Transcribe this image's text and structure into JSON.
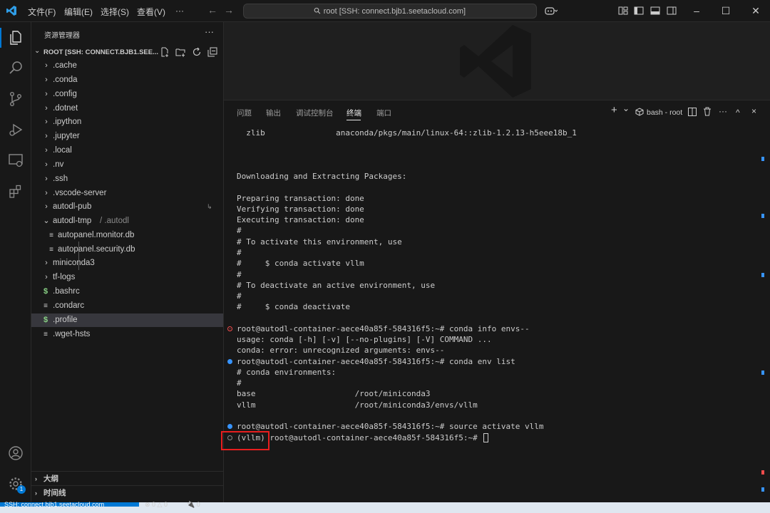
{
  "titlebar": {
    "menus": [
      "文件(F)",
      "编辑(E)",
      "选择(S)",
      "查看(V)",
      "···"
    ],
    "command_center": "root [SSH: connect.bjb1.seetacloud.com]",
    "back": "←",
    "forward": "→"
  },
  "sidebar": {
    "title": "资源管理器",
    "more": "···",
    "root_label": "ROOT [SSH: CONNECT.BJB1.SEE...",
    "items": [
      {
        "label": ".cache",
        "icon": "chevron-right-icon"
      },
      {
        "label": ".conda",
        "icon": "chevron-right-icon"
      },
      {
        "label": ".config",
        "icon": "chevron-right-icon"
      },
      {
        "label": ".dotnet",
        "icon": "chevron-right-icon"
      },
      {
        "label": ".ipython",
        "icon": "chevron-right-icon"
      },
      {
        "label": ".jupyter",
        "icon": "chevron-right-icon"
      },
      {
        "label": ".local",
        "icon": "chevron-right-icon"
      },
      {
        "label": ".nv",
        "icon": "chevron-right-icon"
      },
      {
        "label": ".ssh",
        "icon": "chevron-right-icon"
      },
      {
        "label": ".vscode-server",
        "icon": "chevron-right-icon"
      },
      {
        "label": "autodl-pub",
        "icon": "chevron-right-icon"
      },
      {
        "label": "autodl-tmp",
        "suffix": "/ .autodl",
        "icon": "chevron-down-icon"
      },
      {
        "label": "autopanel.monitor.db",
        "icon": "file-lines-icon"
      },
      {
        "label": "autopanel.security.db",
        "icon": "file-lines-icon"
      },
      {
        "label": "miniconda3",
        "icon": "chevron-right-icon"
      },
      {
        "label": "tf-logs",
        "icon": "chevron-right-icon"
      },
      {
        "label": ".bashrc",
        "icon": "shell-dollar-icon"
      },
      {
        "label": ".condarc",
        "icon": "file-lines-icon"
      },
      {
        "label": ".profile",
        "icon": "shell-dollar-icon",
        "selected": true
      },
      {
        "label": ".wget-hsts",
        "icon": "file-lines-icon"
      }
    ],
    "autodl_pub_marker": "↳",
    "outline": "大纲",
    "timeline": "时间线"
  },
  "panel": {
    "tabs": [
      "问题",
      "输出",
      "调试控制台",
      "终端",
      "端口"
    ],
    "active_tab": "终端",
    "terminal_name": "bash - root",
    "add_terminal": "+",
    "dropdown": "⌄",
    "more": "···",
    "maximize": "^",
    "close": "×"
  },
  "terminal": {
    "lines": [
      {
        "text": "  zlib               anaconda/pkgs/main/linux-64::zlib-1.2.13-h5eee18b_1",
        "deco": ""
      },
      {
        "text": "",
        "deco": ""
      },
      {
        "text": "",
        "deco": ""
      },
      {
        "text": "",
        "deco": ""
      },
      {
        "text": "Downloading and Extracting Packages:",
        "deco": ""
      },
      {
        "text": "",
        "deco": ""
      },
      {
        "text": "Preparing transaction: done",
        "deco": ""
      },
      {
        "text": "Verifying transaction: done",
        "deco": ""
      },
      {
        "text": "Executing transaction: done",
        "deco": ""
      },
      {
        "text": "#",
        "deco": ""
      },
      {
        "text": "# To activate this environment, use",
        "deco": ""
      },
      {
        "text": "#",
        "deco": ""
      },
      {
        "text": "#     $ conda activate vllm",
        "deco": ""
      },
      {
        "text": "#",
        "deco": ""
      },
      {
        "text": "# To deactivate an active environment, use",
        "deco": ""
      },
      {
        "text": "#",
        "deco": ""
      },
      {
        "text": "#     $ conda deactivate",
        "deco": ""
      },
      {
        "text": "",
        "deco": ""
      },
      {
        "text": "root@autodl-container-aece40a85f-584316f5:~# conda info envs--",
        "deco": "err"
      },
      {
        "text": "usage: conda [-h] [-v] [--no-plugins] [-V] COMMAND ...",
        "deco": ""
      },
      {
        "text": "conda: error: unrecognized arguments: envs--",
        "deco": ""
      },
      {
        "text": "root@autodl-container-aece40a85f-584316f5:~# conda env list",
        "deco": "ok"
      },
      {
        "text": "# conda environments:",
        "deco": ""
      },
      {
        "text": "#",
        "deco": ""
      },
      {
        "text": "base                     /root/miniconda3",
        "deco": ""
      },
      {
        "text": "vllm                     /root/miniconda3/envs/vllm",
        "deco": ""
      },
      {
        "text": "",
        "deco": ""
      },
      {
        "text": "root@autodl-container-aece40a85f-584316f5:~# source activate vllm",
        "deco": "ok"
      },
      {
        "text": "(vllm) root@autodl-container-aece40a85f-584316f5:~# ",
        "deco": "idle",
        "cursor": true
      }
    ]
  },
  "statusbar": {
    "remote": "SSH: connect.bjb1.seetacloud.com",
    "problems": "⊗ 0 △ 0",
    "ports": "🔌 0"
  },
  "colors": {
    "accent": "#0078d4",
    "highlight_box": "#e81e1e",
    "error_deco": "#f14c4c",
    "success_deco": "#3794ff"
  }
}
